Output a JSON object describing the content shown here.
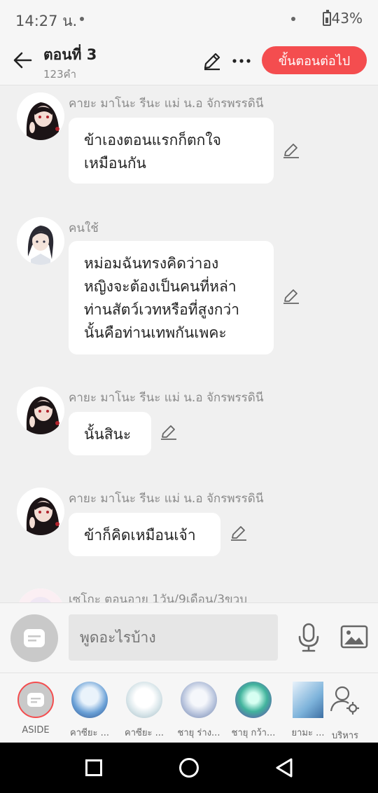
{
  "status": {
    "time": "14:27 น.",
    "battery": "43%"
  },
  "header": {
    "title": "ตอนที่ 3",
    "subtitle": "123คำ",
    "next_label": "ขั้นตอนต่อไป",
    "accent": "#f44d4f"
  },
  "messages": [
    {
      "name": "คายะ มาโนะ รีนะ แม่ น.อ จักรพรรดินี",
      "lines": [
        "ข้าเองตอนแรกก็ตกใจ",
        "เหมือนกัน"
      ]
    },
    {
      "name": "คนใช้",
      "lines": [
        "หม่อมฉันทรงคิดว่าอง",
        "หญิงจะต้องเป็นคนที่หล่า",
        "ท่านสัตว์เวทหรือที่สูงกว่า",
        "นั้นคือท่านเทพกันเพคะ"
      ]
    },
    {
      "name": "คายะ มาโนะ รีนะ แม่ น.อ จักรพรรดินี",
      "lines": [
        "นั้นสินะ"
      ]
    },
    {
      "name": "คายะ มาโนะ รีนะ แม่ น.อ จักรพรรดินี",
      "lines": [
        "ข้าก็คิดเหมือนเจ้า"
      ]
    },
    {
      "name": "เซโกะ ตอนอายุ 1วัน/9เดือน/3ขวบ",
      "lines": []
    }
  ],
  "input": {
    "placeholder": "พูดอะไรบ้าง"
  },
  "characters": [
    {
      "label": "ASIDE"
    },
    {
      "label": "คาซียะ ..."
    },
    {
      "label": "คาซียะ ..."
    },
    {
      "label": "ชายุ ร่าง..."
    },
    {
      "label": "ชายุ กว้า..."
    },
    {
      "label": "ยามะ ..."
    },
    {
      "label": "บริหาร"
    }
  ]
}
